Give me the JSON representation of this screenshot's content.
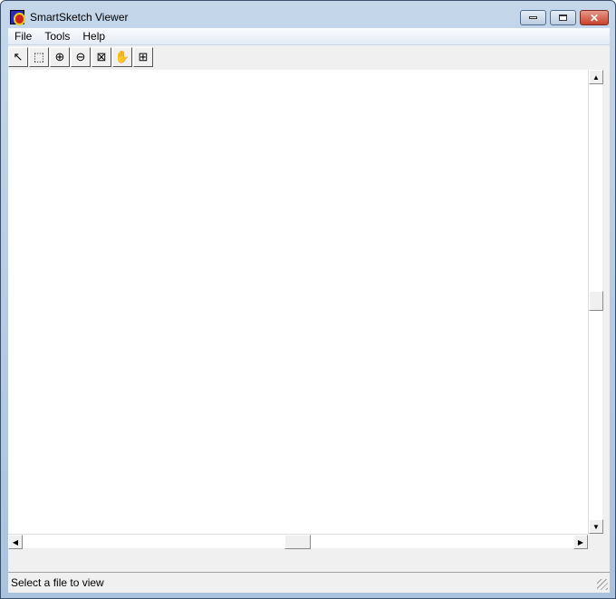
{
  "window": {
    "title": "SmartSketch Viewer"
  },
  "menu": [
    "File",
    "Tools",
    "Help"
  ],
  "toolbar": [
    {
      "name": "select-tool",
      "glyph": "↖"
    },
    {
      "name": "zoom-area",
      "glyph": "⬚"
    },
    {
      "name": "zoom-in",
      "glyph": "⊕"
    },
    {
      "name": "zoom-out",
      "glyph": "⊖"
    },
    {
      "name": "fit",
      "glyph": "⊠"
    },
    {
      "name": "pan",
      "glyph": "✋"
    },
    {
      "name": "center",
      "glyph": "⊞"
    }
  ],
  "status": {
    "text": "Select a file to view"
  }
}
